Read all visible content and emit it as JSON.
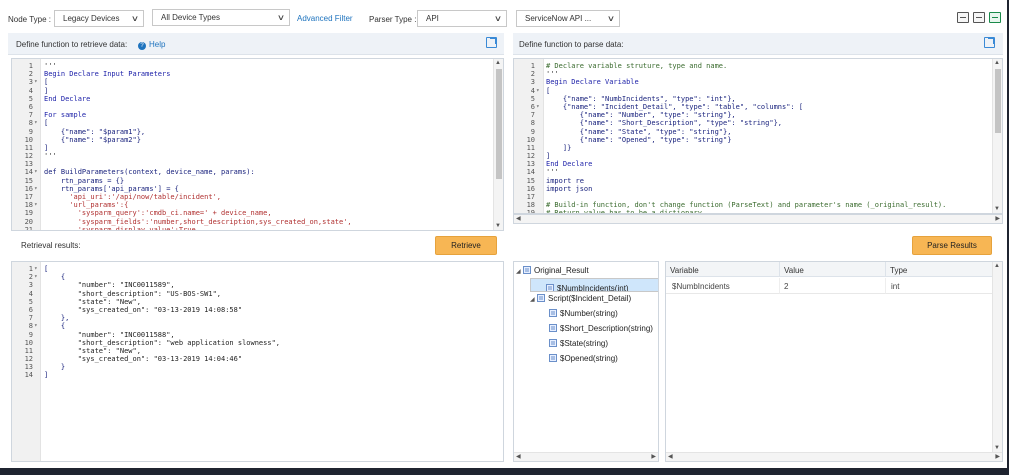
{
  "toolbar": {
    "node_type_label": "Node Type :",
    "node_type_value": "Legacy Devices",
    "device_types_value": "All Device Types",
    "advanced_filter": "Advanced Filter",
    "parser_type_label": "Parser Type :",
    "parser_type_value": "API",
    "template_value": "ServiceNow API ...",
    "icons": [
      "save-icon",
      "save-as-icon",
      "export-icon"
    ]
  },
  "retrieve_panel": {
    "title": "Define function to retrieve data:",
    "help": "Help",
    "code": [
      "'''",
      "Begin Declare Input Parameters",
      "[",
      "]",
      "End Declare",
      "",
      "For sample",
      "[",
      "    {\"name\": \"$param1\"},",
      "    {\"name\": \"$param2\"}",
      "]",
      "'''",
      "",
      "def BuildParameters(context, device_name, params):",
      "    rtn_params = {}",
      "    rtn_params['api_params'] = {",
      "      'api_uri':'/api/now/table/incident',",
      "      'url_params':{",
      "        'sysparm_query':'cmdb_ci.name=' + device_name,",
      "        'sysparm_fields':'number,short_description,sys_created_on,state',",
      "        'sysparm_display_value':True"
    ]
  },
  "parse_panel": {
    "title": "Define function to parse data:",
    "code": [
      "# Declare variable struture, type and name.",
      "'''",
      "Begin Declare Variable",
      "[",
      "    {\"name\": \"NumbIncidents\", \"type\": \"int\"},",
      "    {\"name\": \"Incident_Detail\", \"type\": \"table\", \"columns\": [",
      "        {\"name\": \"Number\", \"type\": \"string\"},",
      "        {\"name\": \"Short_Description\", \"type\": \"string\"},",
      "        {\"name\": \"State\", \"type\": \"string\"},",
      "        {\"name\": \"Opened\", \"type\": \"string\"}",
      "    ]}",
      "]",
      "End Declare",
      "'''",
      "import re",
      "import json",
      "",
      "# Build-in function, don't change function (ParseText) and parameter's name (_original_result).",
      "# Return value has to be a dictionary.",
      "",
      ""
    ]
  },
  "results": {
    "retrieval_label": "Retrieval results:",
    "retrieve_button": "Retrieve",
    "parse_button": "Parse Results",
    "retrieval_code": [
      "[",
      "    {",
      "        \"number\": \"INC0011589\",",
      "        \"short_description\": \"US-BOS-SW1\",",
      "        \"state\": \"New\",",
      "        \"sys_created_on\": \"03-13-2019 14:08:58\"",
      "    },",
      "    {",
      "        \"number\": \"INC0011588\",",
      "        \"short_description\": \"web application slowness\",",
      "        \"state\": \"New\",",
      "        \"sys_created_on\": \"03-13-2019 14:04:46\"",
      "    }",
      "]"
    ]
  },
  "tree": {
    "root": "Original_Result",
    "items": [
      "$NumbIncidents(int)",
      "Script($Incident_Detail)",
      "$Number(string)",
      "$Short_Description(string)",
      "$State(string)",
      "$Opened(string)"
    ]
  },
  "grid": {
    "headers": [
      "Variable",
      "Value",
      "Type"
    ],
    "row": {
      "variable": "$NumbIncidents",
      "value": "2",
      "type": "int"
    }
  }
}
